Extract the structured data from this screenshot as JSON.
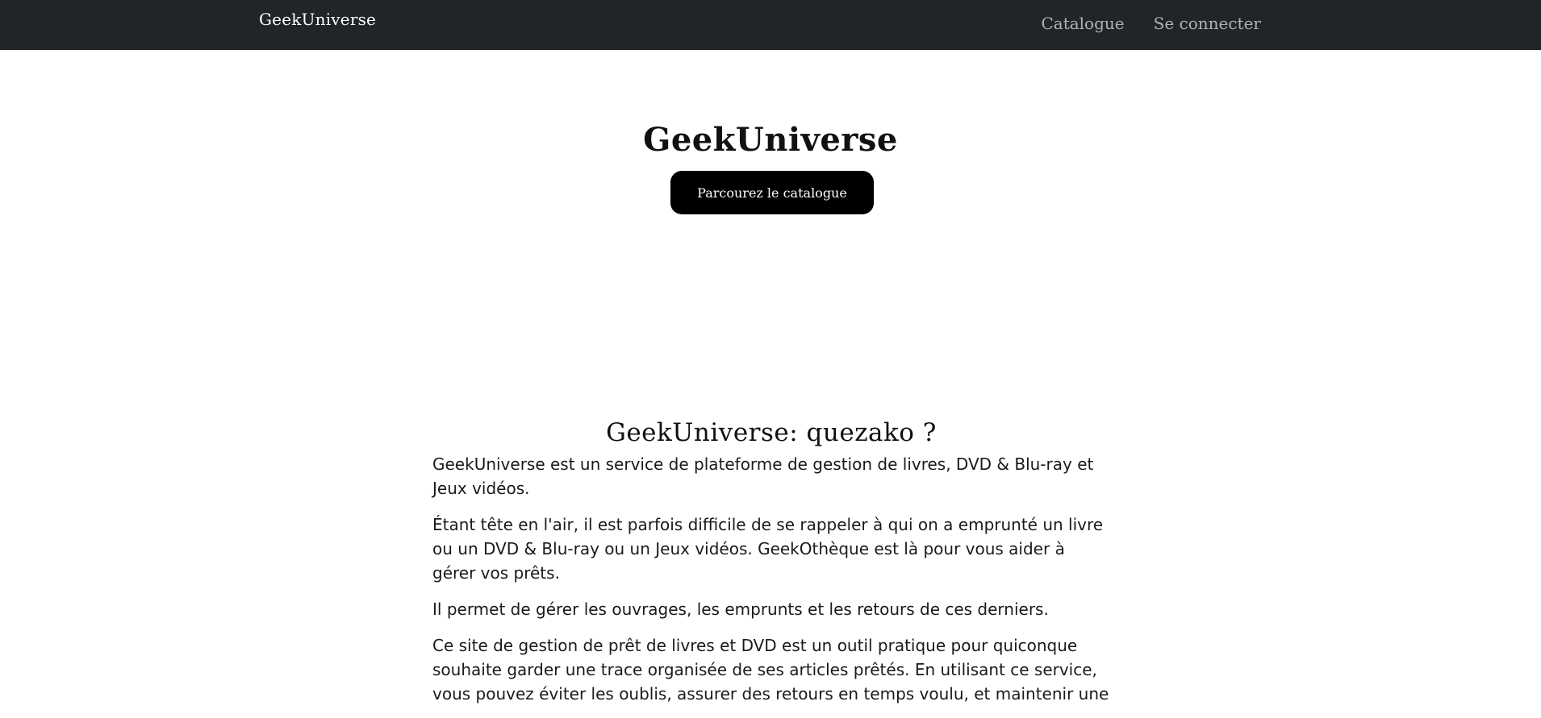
{
  "navbar": {
    "brand": "GeekUniverse",
    "links": [
      {
        "label": "Catalogue"
      },
      {
        "label": "Se connecter"
      }
    ],
    "background_color": "#212529"
  },
  "hero": {
    "title": "GeekUniverse",
    "button_label": "Parcourez le catalogue"
  },
  "about": {
    "title": "GeekUniverse: quezako ?",
    "paragraphs": [
      "GeekUniverse est un service de plateforme de gestion de livres, DVD & Blu-ray et Jeux vidéos.",
      "Étant tête en l'air, il est parfois difficile de se rappeler à qui on a emprunté un livre ou un DVD & Blu-ray ou un Jeux vidéos. GeekOthèque est là pour vous aider à gérer vos prêts.",
      "Il permet de gérer les ouvrages, les emprunts et les retours de ces derniers.",
      "Ce site de gestion de prêt de livres et DVD est un outil pratique pour quiconque souhaite garder une trace organisée de ses articles prêtés. En utilisant ce service, vous pouvez éviter les oublis, assurer des retours en temps voulu, et maintenir une"
    ]
  }
}
